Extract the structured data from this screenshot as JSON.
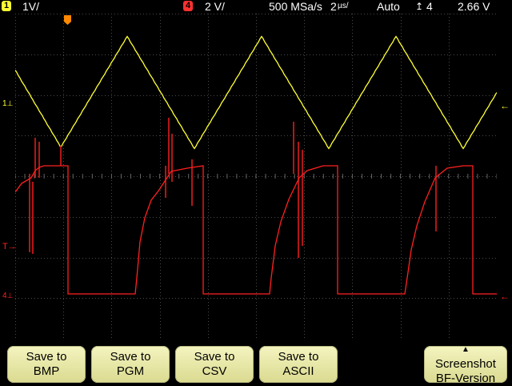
{
  "status_bar": {
    "ch1_number": "1",
    "ch1_scale": "1V/",
    "ch4_number": "4",
    "ch4_scale": "2 V/",
    "sample_rate": "500 MSa/s",
    "timebase_value": "2",
    "timebase_unit": "µs/",
    "trigger_mode": "Auto",
    "trigger_source": "4",
    "trigger_level": "2.66  V"
  },
  "colors": {
    "ch1": "#ffff33",
    "ch4": "#ff2020",
    "grid": "#4a4a4a",
    "trigger": "#ff8800",
    "softkey_face": "#eeeeb4"
  },
  "markers": {
    "ch1_left": "1",
    "ch4_left": "4"
  },
  "softkeys": [
    {
      "line1": "Save to",
      "line2": "BMP"
    },
    {
      "line1": "Save to",
      "line2": "PGM"
    },
    {
      "line1": "Save to",
      "line2": "CSV"
    },
    {
      "line1": "Save to",
      "line2": "ASCII"
    },
    {
      "line1": "Screenshot",
      "line2": "BF-Version"
    }
  ]
}
